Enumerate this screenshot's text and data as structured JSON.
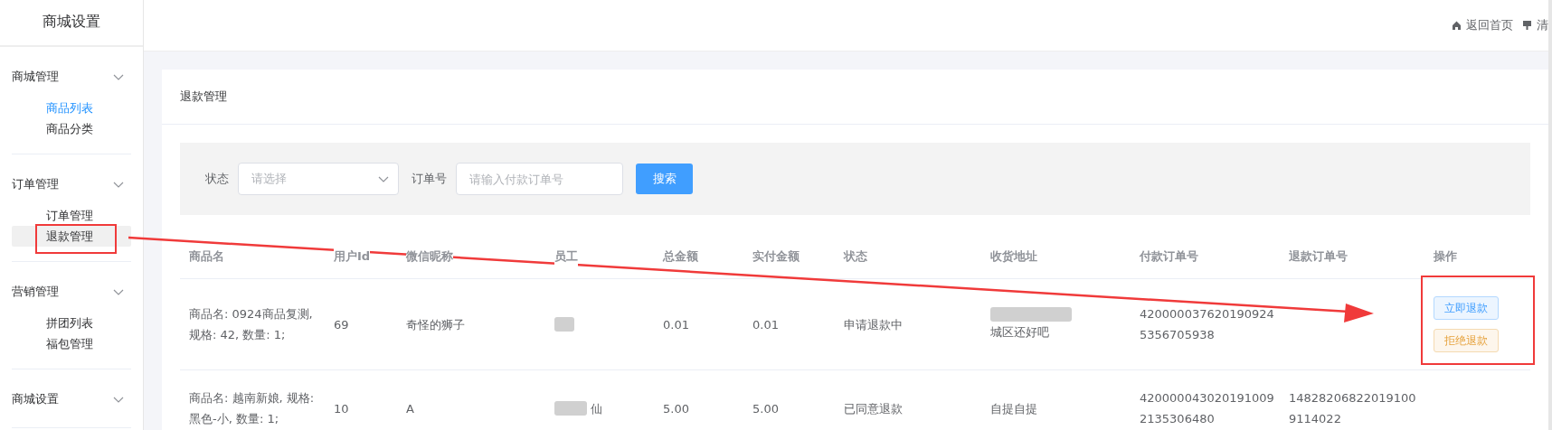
{
  "sidebar": {
    "title": "商城设置",
    "groups": [
      {
        "label": "商城管理",
        "expanded": true,
        "items": [
          {
            "label": "商品列表",
            "current": true,
            "selected": false
          },
          {
            "label": "商品分类",
            "current": false,
            "selected": false
          }
        ]
      },
      {
        "label": "订单管理",
        "expanded": true,
        "items": [
          {
            "label": "订单管理",
            "current": false,
            "selected": false
          },
          {
            "label": "退款管理",
            "current": false,
            "selected": true
          }
        ]
      },
      {
        "label": "营销管理",
        "expanded": true,
        "items": [
          {
            "label": "拼团列表",
            "current": false,
            "selected": false
          },
          {
            "label": "福包管理",
            "current": false,
            "selected": false
          }
        ]
      },
      {
        "label": "商城设置",
        "expanded": true
      }
    ]
  },
  "header": {
    "links": [
      {
        "kind": "home",
        "label": "返回首页"
      },
      {
        "kind": "brush",
        "label": "清"
      }
    ]
  },
  "card": {
    "title": "退款管理",
    "filters": {
      "status_label": "状态",
      "status_placeholder": "请选择",
      "order_label": "订单号",
      "order_placeholder": "请输入付款订单号",
      "search_button": "搜索"
    },
    "table": {
      "columns": [
        "商品名",
        "用户Id",
        "微信昵称",
        "员工",
        "总金额",
        "实付金额",
        "状态",
        "收货地址",
        "付款订单号",
        "退款订单号",
        "操作"
      ],
      "rows": [
        {
          "product": "商品名: 0924商品复测, 规格: 42, 数量: 1;",
          "user_id": "69",
          "nickname": "奇怪的狮子",
          "staff": {
            "redacted": true
          },
          "total": "0.01",
          "paid": "0.01",
          "status": "申请退款中",
          "address": {
            "redacted": true,
            "text": "城区还好吧"
          },
          "pay_order": "4200000376201909245356705938",
          "actions": [
            {
              "kind": "primary",
              "label": "立即退款"
            },
            {
              "kind": "warning",
              "label": "拒绝退款"
            }
          ]
        },
        {
          "product": "商品名: 越南新娘, 规格: 黑色-小, 数量: 1;",
          "user_id": "10",
          "nickname": "A",
          "staff": {
            "redacted": true,
            "text": "仙"
          },
          "total": "5.00",
          "paid": "5.00",
          "status": "已同意退款",
          "address": {
            "redacted": false,
            "text": "自提自提"
          },
          "pay_order": "4200000430201910092135306480",
          "refund_order": "148282068220191009114022",
          "actions": []
        }
      ]
    }
  }
}
